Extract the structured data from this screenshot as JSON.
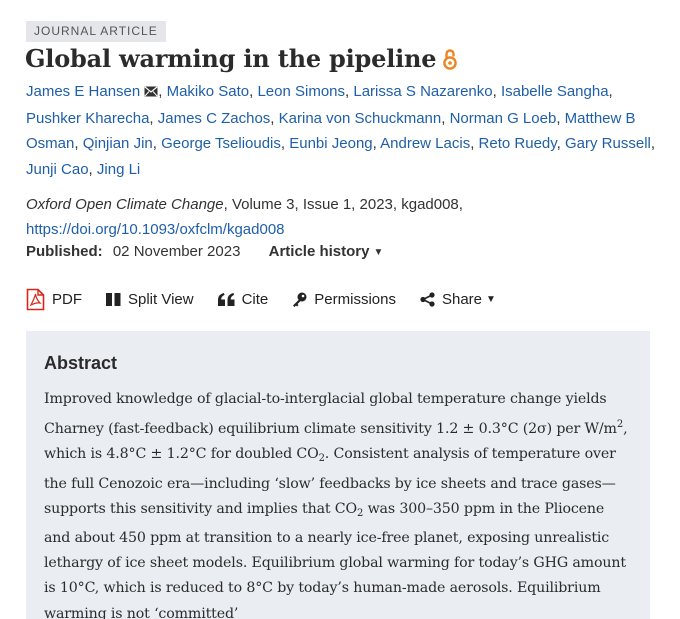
{
  "badge": "JOURNAL ARTICLE",
  "title": "Global warming in the pipeline",
  "authors": [
    "James E Hansen",
    "Makiko Sato",
    "Leon Simons",
    "Larissa S Nazarenko",
    "Isabelle Sangha",
    "Pushker Kharecha",
    "James C Zachos",
    "Karina von Schuckmann",
    "Norman G Loeb",
    "Matthew B Osman",
    "Qinjian Jin",
    "George Tselioudis",
    "Eunbi Jeong",
    "Andrew Lacis",
    "Reto Ruedy",
    "Gary Russell",
    "Junji Cao",
    "Jing Li"
  ],
  "citation": {
    "journal": "Oxford Open Climate Change",
    "details": ", Volume 3, Issue 1, 2023, kgad008,",
    "doi": "https://doi.org/10.1093/oxfclm/kgad008"
  },
  "published": {
    "label": "Published:",
    "date": "02 November 2023",
    "history": "Article history"
  },
  "toolbar": {
    "pdf": "PDF",
    "split_view": "Split View",
    "cite": "Cite",
    "permissions": "Permissions",
    "share": "Share"
  },
  "abstract": {
    "heading": "Abstract",
    "t1": "Improved knowledge of glacial-to-interglacial global temperature change yields Charney (fast-feedback) equilibrium climate sensitivity 1.2 ± 0.3°C (2σ) per W/m",
    "t1_sup": "2",
    "t2": ", which is 4.8°C ± 1.2°C for doubled CO",
    "t2_sub": "2",
    "t3": ". Consistent analysis of temperature over the full Cenozoic era—including ‘slow’ feedbacks by ice sheets and trace gases—supports this sensitivity and implies that CO",
    "t3_sub": "2",
    "t4": " was 300–350 ppm in the Pliocene and about 450 ppm at transition to a nearly ice-free planet, exposing unrealistic lethargy of ice sheet models. Equilibrium global warming for today’s GHG amount is 10°C, which is reduced to 8°C by today’s human-made aerosols. Equilibrium warming is not ‘committed’"
  },
  "colors": {
    "link": "#1f5fa8",
    "open_access": "#f0821e",
    "pdf_icon": "#d9261c",
    "abstract_bg": "#eaedf1"
  }
}
